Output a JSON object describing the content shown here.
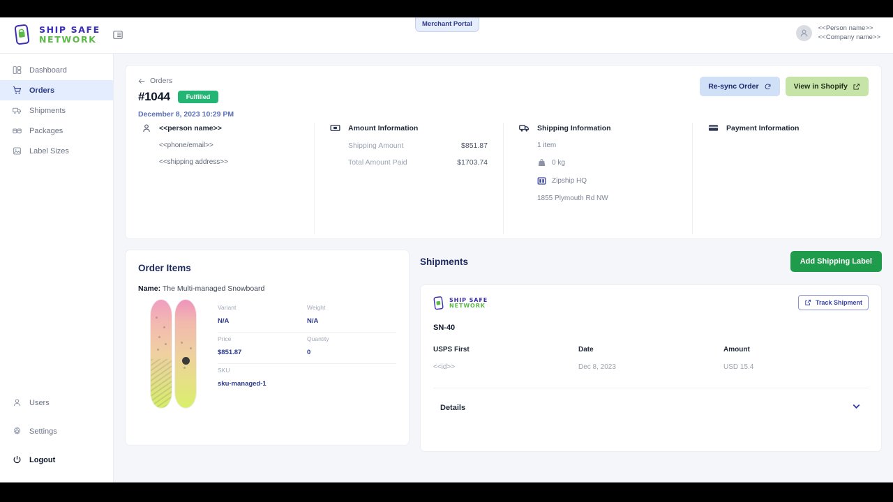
{
  "app": {
    "brand_line1": "SHIP SAFE",
    "brand_line2": "NETWORK",
    "portal_badge": "Merchant Portal",
    "user_name": "<<Person name>>",
    "company_name": "<<Company name>>"
  },
  "sidebar": {
    "top_items": [
      {
        "label": "Dashboard",
        "icon": "dashboard-icon",
        "active": false
      },
      {
        "label": "Orders",
        "icon": "cart-icon",
        "active": true
      },
      {
        "label": "Shipments",
        "icon": "truck-icon",
        "active": false
      },
      {
        "label": "Packages",
        "icon": "box-icon",
        "active": false
      },
      {
        "label": "Label Sizes",
        "icon": "label-icon",
        "active": false
      }
    ],
    "bottom_items": [
      {
        "label": "Users",
        "icon": "user-icon"
      },
      {
        "label": "Settings",
        "icon": "gear-icon"
      },
      {
        "label": "Logout",
        "icon": "power-icon"
      }
    ]
  },
  "order": {
    "back_label": "Orders",
    "id": "#1044",
    "status": "Fulfilled",
    "date": "December 8, 2023 10:29 PM",
    "resync_label": "Re-sync Order",
    "shopify_label": "View in Shopify"
  },
  "customer": {
    "name": "<<person name>>",
    "contact": "<<phone/email>>",
    "address": "<<shipping address>>"
  },
  "amount": {
    "title": "Amount Information",
    "rows": [
      {
        "label": "Shipping Amount",
        "value": "$851.87"
      },
      {
        "label": "Total Amount Paid",
        "value": "$1703.74"
      }
    ]
  },
  "shipping_info": {
    "title": "Shipping Information",
    "items_count": "1 item",
    "weight": "0 kg",
    "location": "Zipship HQ",
    "street": "1855 Plymouth Rd NW"
  },
  "payment_info": {
    "title": "Payment Information"
  },
  "order_items": {
    "title": "Order Items",
    "name_label": "Name:",
    "product_name": "The Multi-managed Snowboard",
    "specs": [
      [
        {
          "label": "Variant",
          "value": "N/A"
        },
        {
          "label": "Weight",
          "value": "N/A"
        }
      ],
      [
        {
          "label": "Price",
          "value": "$851.87"
        },
        {
          "label": "Quantity",
          "value": "0"
        }
      ],
      [
        {
          "label": "SKU",
          "value": "sku-managed-1"
        }
      ]
    ]
  },
  "shipments": {
    "title": "Shipments",
    "add_label_button": "Add Shipping Label",
    "track_button": "Track Shipment",
    "shipment_number": "SN-40",
    "columns": [
      {
        "label": "USPS First",
        "value": "<<id>>"
      },
      {
        "label": "Date",
        "value": "Dec 8, 2023"
      },
      {
        "label": "Amount",
        "value": "USD 15.4"
      }
    ],
    "details_label": "Details"
  },
  "colors": {
    "accent_blue": "#2b3a8f",
    "brand_green": "#5bb947",
    "status_green": "#22b573",
    "add_button_green": "#1f9c4b",
    "sidebar_active": "#e3edfd"
  }
}
